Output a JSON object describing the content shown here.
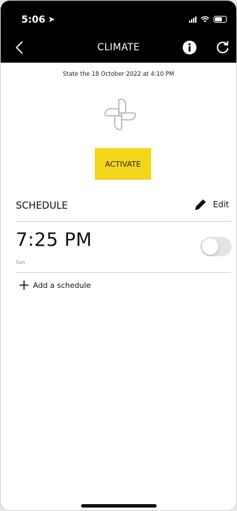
{
  "status_bar": {
    "time": "5:06",
    "location_icon": "location-arrow-icon",
    "icons": [
      "signal-icon",
      "wifi-icon",
      "battery-icon"
    ]
  },
  "nav": {
    "title": "CLIMATE",
    "back_icon": "chevron-left-icon",
    "info_icon": "info-icon",
    "refresh_icon": "refresh-icon"
  },
  "state": {
    "text": "State the 18 October 2022 at 4:10 PM"
  },
  "activate_label": "ACTIVATE",
  "schedule": {
    "header": "SCHEDULE",
    "edit_label": "Edit",
    "items": [
      {
        "time": "7:25 PM",
        "days": "Sun",
        "enabled": false
      }
    ],
    "add_label": "Add a schedule"
  },
  "colors": {
    "accent": "#f4d61a",
    "header_bg": "#000000",
    "toggle_off": "#e4e4e4"
  }
}
